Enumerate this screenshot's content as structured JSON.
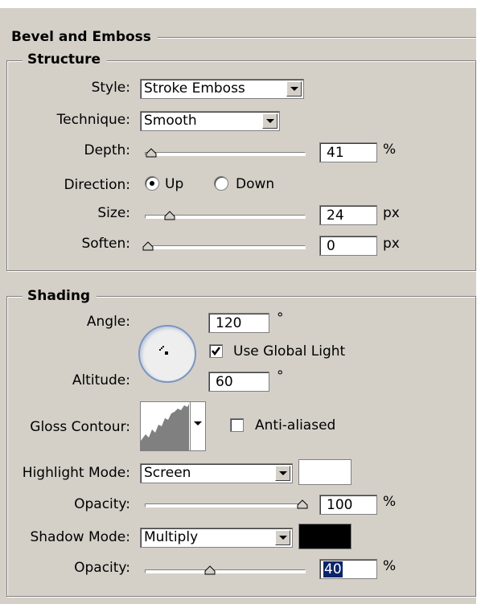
{
  "section_title": "Bevel and Emboss",
  "structure": {
    "title": "Structure",
    "style": {
      "label": "Style:",
      "value": "Stroke Emboss"
    },
    "technique": {
      "label": "Technique:",
      "value": "Smooth"
    },
    "depth": {
      "label": "Depth:",
      "value": "41",
      "unit": "%",
      "slider_fraction": 0.02
    },
    "direction": {
      "label": "Direction:",
      "options": [
        "Up",
        "Down"
      ],
      "selected": "Up"
    },
    "size": {
      "label": "Size:",
      "value": "24",
      "unit": "px",
      "slider_fraction": 0.14
    },
    "soften": {
      "label": "Soften:",
      "value": "0",
      "unit": "px",
      "slider_fraction": 0.0
    }
  },
  "shading": {
    "title": "Shading",
    "angle": {
      "label": "Angle:",
      "value": "120",
      "unit": "°"
    },
    "use_global_light": {
      "label": "Use Global Light",
      "checked": true
    },
    "altitude": {
      "label": "Altitude:",
      "value": "60",
      "unit": "°"
    },
    "gloss_contour": {
      "label": "Gloss Contour:"
    },
    "anti_aliased": {
      "label": "Anti-aliased",
      "checked": false
    },
    "highlight_mode": {
      "label": "Highlight Mode:",
      "value": "Screen",
      "color": "#ffffff"
    },
    "highlight_opacity": {
      "label": "Opacity:",
      "value": "100",
      "unit": "%",
      "slider_fraction": 1.0
    },
    "shadow_mode": {
      "label": "Shadow Mode:",
      "value": "Multiply",
      "color": "#000000"
    },
    "shadow_opacity": {
      "label": "Opacity:",
      "value": "40",
      "unit": "%",
      "slider_fraction": 0.4
    }
  }
}
